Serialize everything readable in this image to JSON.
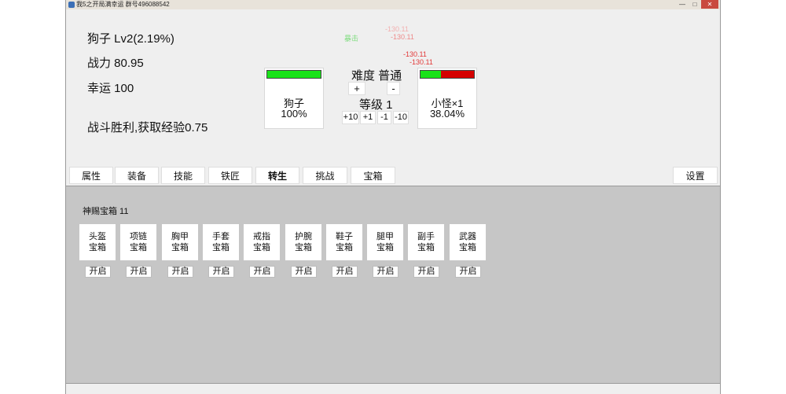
{
  "window": {
    "title": "我5之开局满幸运 群号496088542",
    "controls": [
      "—",
      "□",
      "✕"
    ]
  },
  "stats": {
    "name_level": "狗子 Lv2(2.19%)",
    "power": "战力 80.95",
    "luck": "幸运 100",
    "battle_result": "战斗胜利,获取经验0.75"
  },
  "floating_texts": [
    {
      "text": "暴击",
      "color": "#7fdc7f"
    },
    {
      "text": "-130.11",
      "color": "#f2b0b0"
    },
    {
      "text": "-130.11",
      "color": "#ee8a8a"
    },
    {
      "text": "-130.11",
      "color": "#e23838"
    },
    {
      "text": "-130.11",
      "color": "#e23838"
    }
  ],
  "player_card": {
    "name": "狗子",
    "percent_text": "100%",
    "hp_fraction": 1.0
  },
  "enemy_card": {
    "name": "小怪×1",
    "percent_text": "38.04%",
    "hp_fraction": 0.3804
  },
  "difficulty": {
    "label": "难度 普通",
    "inc": "+",
    "dec": "-"
  },
  "level_ctrl": {
    "label": "等级 1",
    "buttons": [
      "+10",
      "+1",
      "-1",
      "-10"
    ]
  },
  "tabs": [
    "属性",
    "装备",
    "技能",
    "铁匠",
    "转生",
    "挑战",
    "宝箱"
  ],
  "active_tab": "转生",
  "settings_label": "设置",
  "chest_panel": {
    "title": "神赐宝箱 11",
    "chests": [
      {
        "line1": "头盔",
        "line2": "宝箱"
      },
      {
        "line1": "项链",
        "line2": "宝箱"
      },
      {
        "line1": "胸甲",
        "line2": "宝箱"
      },
      {
        "line1": "手套",
        "line2": "宝箱"
      },
      {
        "line1": "戒指",
        "line2": "宝箱"
      },
      {
        "line1": "护腕",
        "line2": "宝箱"
      },
      {
        "line1": "鞋子",
        "line2": "宝箱"
      },
      {
        "line1": "腿甲",
        "line2": "宝箱"
      },
      {
        "line1": "副手",
        "line2": "宝箱"
      },
      {
        "line1": "武器",
        "line2": "宝箱"
      }
    ],
    "open_label": "开启"
  },
  "colors": {
    "hp_green": "#19e219",
    "hp_red": "#d40000",
    "panel_bg": "#c6c6c6",
    "window_bg": "#efefef"
  }
}
